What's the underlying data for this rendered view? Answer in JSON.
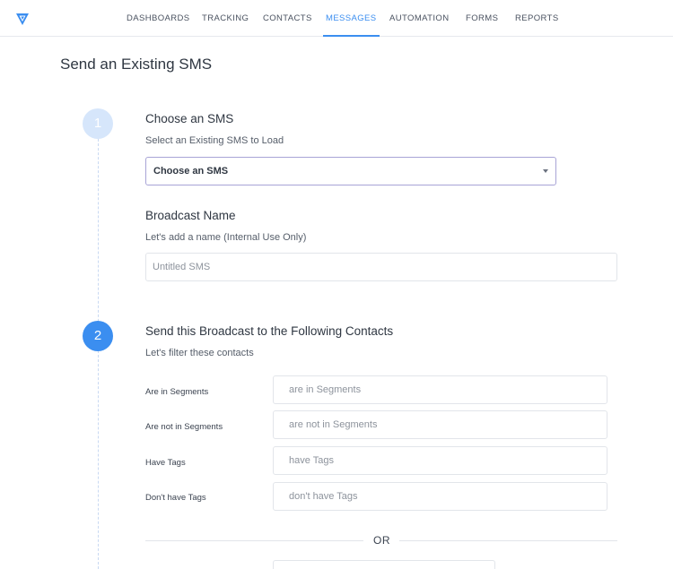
{
  "nav": {
    "items": [
      {
        "label": "DASHBOARDS"
      },
      {
        "label": "TRACKING"
      },
      {
        "label": "CONTACTS"
      },
      {
        "label": "MESSAGES",
        "active": true
      },
      {
        "label": "AUTOMATION"
      },
      {
        "label": "FORMS"
      },
      {
        "label": "REPORTS"
      }
    ]
  },
  "page": {
    "title": "Send an Existing SMS"
  },
  "step1": {
    "number": "1",
    "title": "Choose an SMS",
    "subtitle": "Select an Existing SMS to Load",
    "select_value": "Choose an SMS",
    "broadcast_title": "Broadcast Name",
    "broadcast_subtitle": "Let's add a name (Internal Use Only)",
    "broadcast_placeholder": "Untitled SMS"
  },
  "step2": {
    "number": "2",
    "title": "Send this Broadcast to the Following Contacts",
    "subtitle": "Let's filter these contacts",
    "filters": [
      {
        "label": "Are in Segments",
        "placeholder": "are in Segments"
      },
      {
        "label": "Are not in Segments",
        "placeholder": "are not in Segments"
      },
      {
        "label": "Have Tags",
        "placeholder": "have Tags"
      },
      {
        "label": "Don't have Tags",
        "placeholder": "don't have Tags"
      }
    ],
    "or_label": "OR"
  },
  "colors": {
    "accent": "#3b8ef0",
    "step_inactive": "#d6e6fb",
    "select_border": "#a8a4d6"
  },
  "icons": {
    "logo": "brand-logo-icon",
    "select_caret": "caret-down-icon"
  }
}
